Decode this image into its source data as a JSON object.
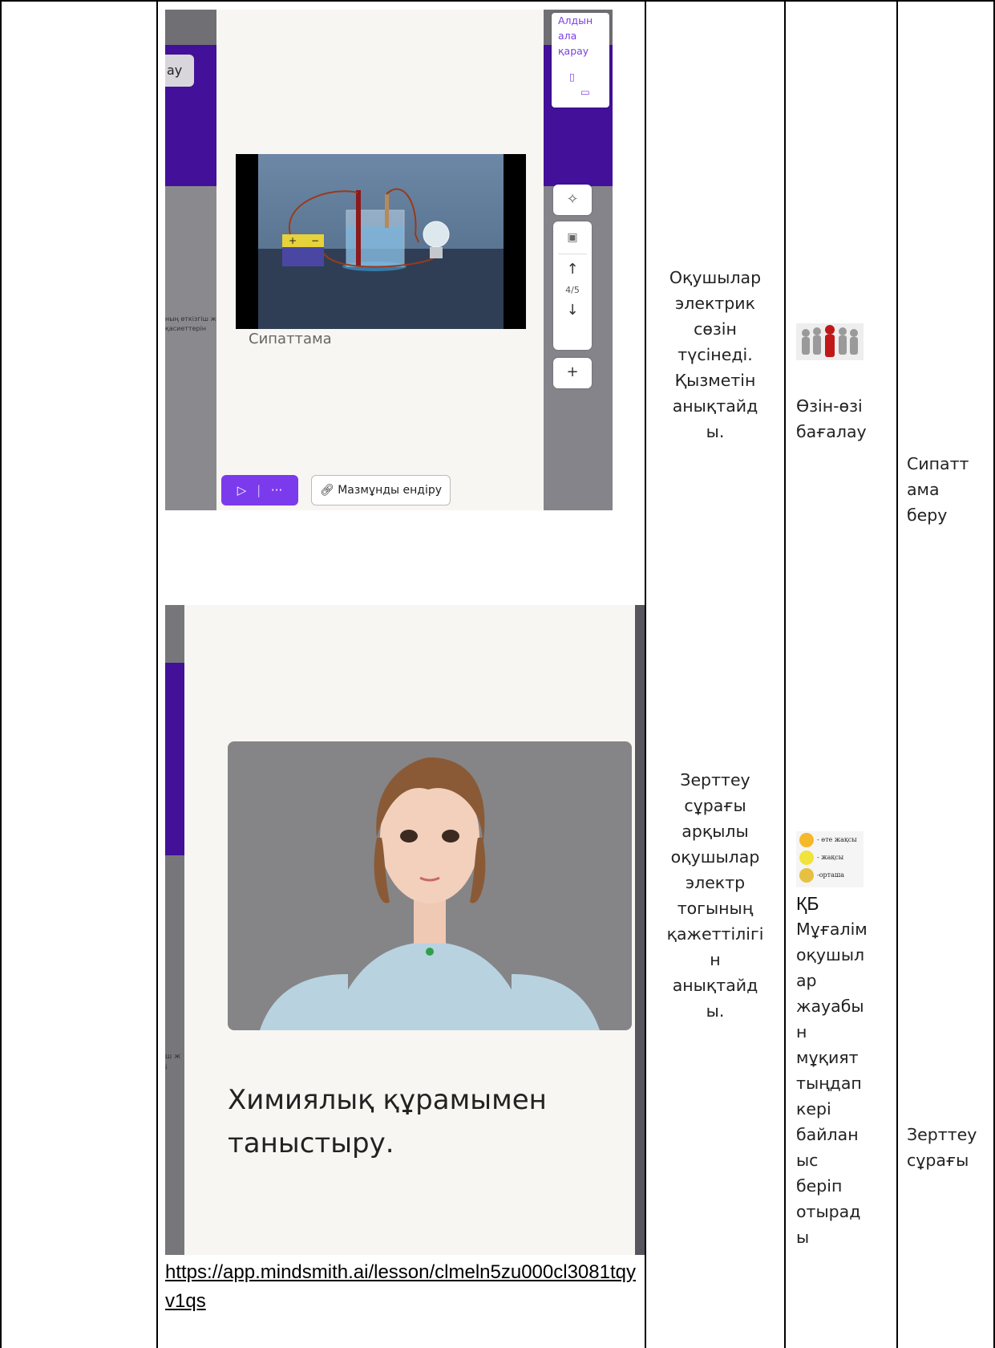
{
  "screenshot1": {
    "preview_label": "Алдын ала қарау",
    "preview_lines": [
      "Алдын",
      "ала",
      "қарау"
    ],
    "tab_fragment": "ау",
    "caption": "Сипаттама",
    "slide_counter": "4/5",
    "insert_button": "Мазмұнды ендіру",
    "side_text": [
      "ның өткізгіш ж",
      "қасиеттерін"
    ]
  },
  "screenshot2": {
    "heading_lines": [
      "Химиялық құрамымен",
      "таныстыру."
    ],
    "side_text": [
      "ш ж",
      "і"
    ]
  },
  "link": "https://app.mindsmith.ai/lesson/clmeln5zu000cl3081tqyv1qs",
  "column3": {
    "row1_lines": [
      "Оқушылар",
      "электрик",
      "сөзін",
      "түсінеді.",
      "Қызметін",
      "анықтайд",
      "ы."
    ],
    "row2_lines": [
      "Зерттеу",
      "сұрағы",
      "арқылы",
      "оқушылар",
      "электр",
      "тогының",
      "қажеттілігі",
      "н",
      "анықтайд",
      "ы."
    ]
  },
  "column4": {
    "row1_lines": [
      "Өзін-өзі",
      "бағалау"
    ],
    "legend": [
      "- өте жақсы",
      "- жақсы",
      "-орташа"
    ],
    "row2_title": "ҚБ",
    "row2_lines": [
      "Мұғалім",
      "оқушыл",
      "ар",
      "жауабы",
      "н",
      "мұқият",
      "тыңдап",
      "кері",
      "байлан",
      "ыс",
      "беріп",
      "отырад",
      "ы"
    ]
  },
  "column5": {
    "row1_lines": [
      "Сипатт",
      "ама",
      "беру"
    ],
    "row2_lines": [
      "Зерттеу",
      "сұрағы"
    ]
  }
}
